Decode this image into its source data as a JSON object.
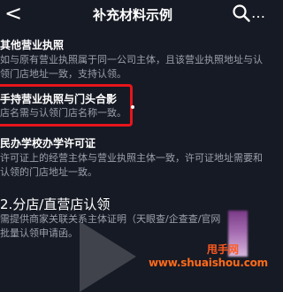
{
  "header": {
    "back_symbol": "<",
    "title": "补充材料示例",
    "more_symbol": "…"
  },
  "sections": [
    {
      "heading": "其他营业执照",
      "lines": [
        "如与原有营业执照属于同一公司主体，且该营业执照地址与认",
        "领门店地址一致，支持认领。"
      ]
    },
    {
      "heading": "手持营业执照与门头合影",
      "lines": [
        "店名需与认领门店名称一致。"
      ]
    },
    {
      "heading": "民办学校办学许可证",
      "lines": [
        "许可证上的经营主体与营业执照主体一致，许可证地址需要和",
        "认领的门店地址一致。"
      ]
    },
    {
      "heading": "2.分店/直营店认领",
      "lines": [
        "需提供商家关联关系主体证明（天眼查/企查查/官网",
        "批量认领申请函。"
      ]
    }
  ],
  "watermark": {
    "label": "甩手网",
    "url": "www.shuaishou.com"
  },
  "colors": {
    "background": "#161a24",
    "highlight": "#e8151b",
    "watermark": "#ff6a1a"
  }
}
